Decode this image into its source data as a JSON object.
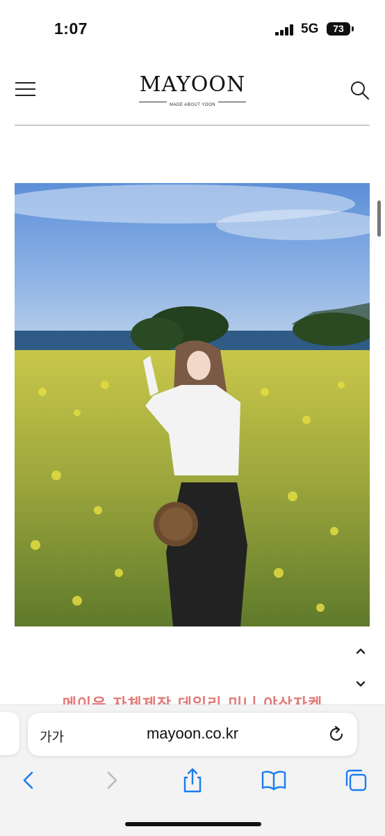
{
  "status_bar": {
    "time": "1:07",
    "network": "5G",
    "battery": "73"
  },
  "header": {
    "logo": "MAYOON",
    "logo_tagline": "MADE ABOUT YOON",
    "menu_icon": "hamburger-menu-icon",
    "search_icon": "search-icon"
  },
  "product": {
    "image_description_icon": "product-photo",
    "title": "메이윤 자체제작 데일리 미니 야상자켓"
  },
  "scroll_controls": {
    "up_icon": "chevron-up-icon",
    "down_icon": "chevron-down-icon"
  },
  "browser": {
    "text_size_label": "가가",
    "url": "mayoon.co.kr",
    "toolbar": [
      "back-icon",
      "forward-icon",
      "share-icon",
      "bookmarks-icon",
      "tabs-icon"
    ]
  },
  "colors": {
    "accent_title": "#e07a78",
    "link_blue": "#1a7cf0",
    "divider": "#c9c9c9"
  }
}
